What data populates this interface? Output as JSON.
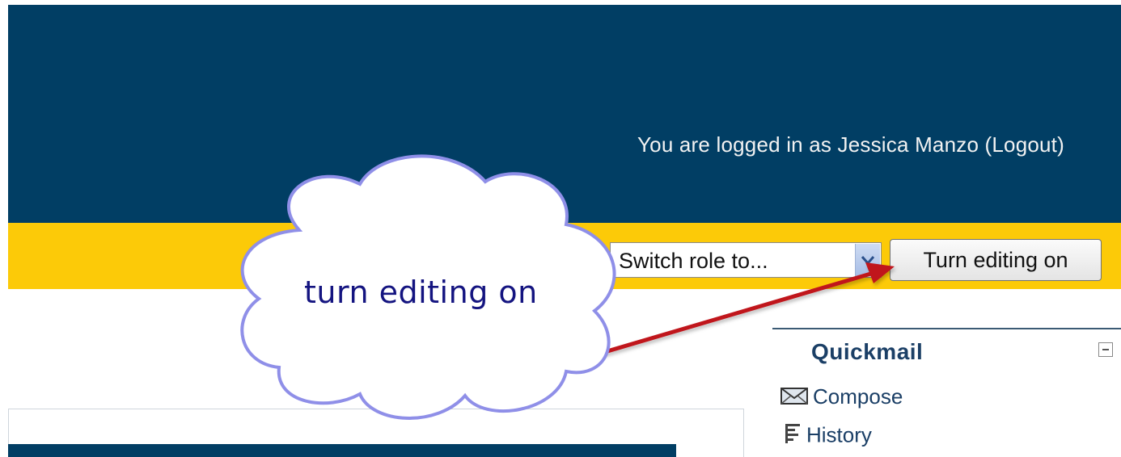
{
  "header": {
    "login_info": "You are logged in as Jessica Manzo (Logout)",
    "bg_color": "#013e64"
  },
  "navbar": {
    "bg_color": "#fcca08",
    "help_icon": "help-icon",
    "help_symbol": "?",
    "role_select": {
      "value": "Switch role to...",
      "arrow_icon": "chevron-down-icon"
    },
    "edit_button_label": "Turn editing on"
  },
  "quickmail": {
    "title": "Quickmail",
    "collapse_icon": "collapse-icon",
    "items": [
      {
        "label": "Compose",
        "icon": "envelope-icon"
      },
      {
        "label": "History",
        "icon": "list-icon"
      }
    ]
  },
  "annotation": {
    "callout_text": "turn editing on",
    "arrow_color": "#c0161d",
    "cloud_border_color": "#8f8fe8"
  }
}
